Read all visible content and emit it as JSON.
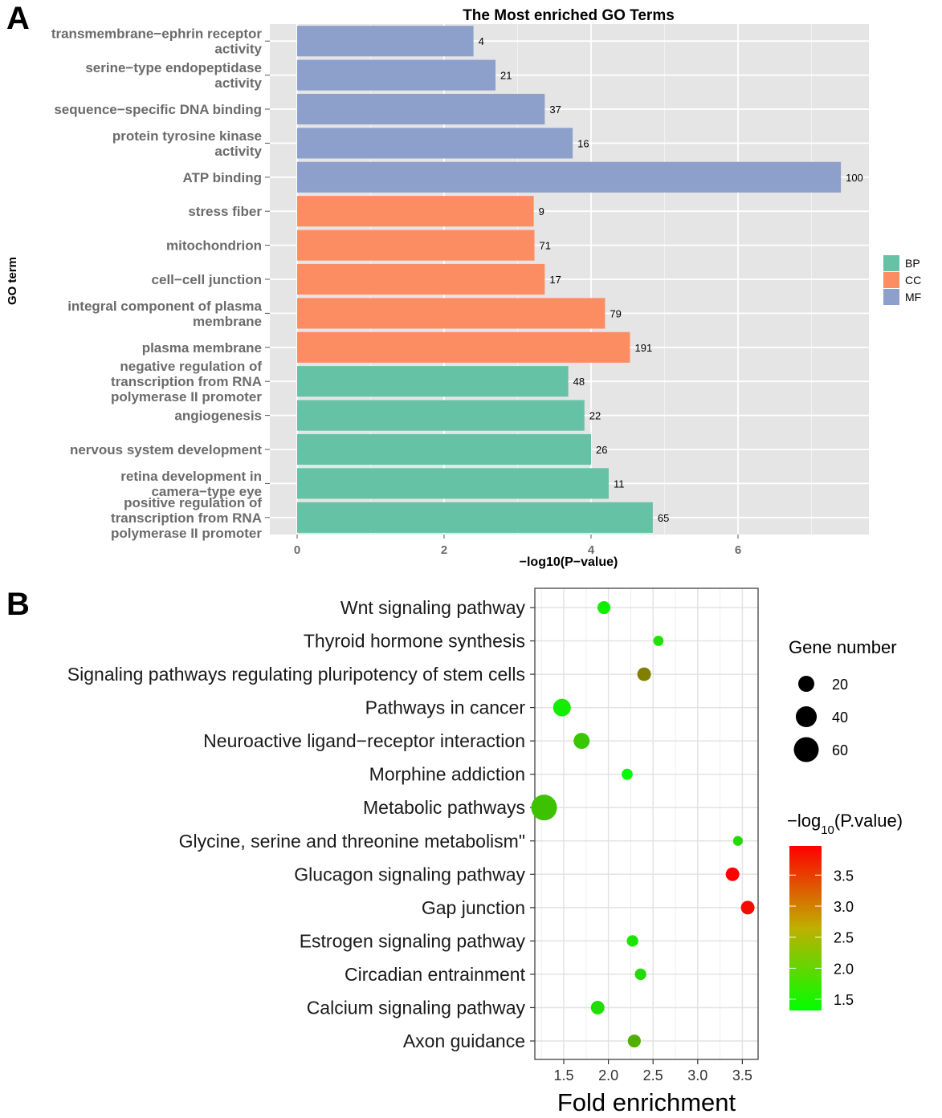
{
  "panels": {
    "a_label": "A",
    "b_label": "B"
  },
  "chart_data": [
    {
      "type": "bar",
      "orientation": "horizontal",
      "title": "The Most enriched GO Terms",
      "xlabel": "−log10(P−value)",
      "ylabel": "GO term",
      "xlim": [
        -0.35,
        7.8
      ],
      "xticks": [
        "0",
        "2",
        "4",
        "6"
      ],
      "xtick_values": [
        0,
        2,
        4,
        6
      ],
      "grid": true,
      "legend": {
        "placement": "right",
        "entries": [
          {
            "name": "BP",
            "color": "#66c2a5"
          },
          {
            "name": "CC",
            "color": "#fc8d62"
          },
          {
            "name": "MF",
            "color": "#8da0cb"
          }
        ]
      },
      "categories": [
        {
          "lines": [
            "transmembrane−ephrin receptor",
            "activity"
          ],
          "group": "MF",
          "value": 2.4,
          "count": "4"
        },
        {
          "lines": [
            "serine−type endopeptidase",
            "activity"
          ],
          "group": "MF",
          "value": 2.7,
          "count": "21"
        },
        {
          "lines": [
            "sequence−specific DNA binding"
          ],
          "group": "MF",
          "value": 3.37,
          "count": "37"
        },
        {
          "lines": [
            "protein tyrosine kinase",
            "activity"
          ],
          "group": "MF",
          "value": 3.75,
          "count": "16"
        },
        {
          "lines": [
            "ATP binding"
          ],
          "group": "MF",
          "value": 7.4,
          "count": "100"
        },
        {
          "lines": [
            "stress fiber"
          ],
          "group": "CC",
          "value": 3.22,
          "count": "9"
        },
        {
          "lines": [
            "mitochondrion"
          ],
          "group": "CC",
          "value": 3.23,
          "count": "71"
        },
        {
          "lines": [
            "cell−cell junction"
          ],
          "group": "CC",
          "value": 3.37,
          "count": "17"
        },
        {
          "lines": [
            "integral component of plasma",
            "membrane"
          ],
          "group": "CC",
          "value": 4.19,
          "count": "79"
        },
        {
          "lines": [
            "plasma membrane"
          ],
          "group": "CC",
          "value": 4.53,
          "count": "191"
        },
        {
          "lines": [
            "negative regulation of",
            "transcription from RNA",
            "polymerase II promoter"
          ],
          "group": "BP",
          "value": 3.69,
          "count": "48"
        },
        {
          "lines": [
            "angiogenesis"
          ],
          "group": "BP",
          "value": 3.91,
          "count": "22"
        },
        {
          "lines": [
            "nervous system development"
          ],
          "group": "BP",
          "value": 4.0,
          "count": "26"
        },
        {
          "lines": [
            "retina development in",
            "camera−type eye"
          ],
          "group": "BP",
          "value": 4.24,
          "count": "11"
        },
        {
          "lines": [
            "positive regulation of",
            "transcription from RNA",
            "polymerase II promoter"
          ],
          "group": "BP",
          "value": 4.84,
          "count": "65"
        }
      ]
    },
    {
      "type": "scatter",
      "subtype": "bubble",
      "title": "",
      "xlabel": "Fold enrichment",
      "ylabel": "",
      "xlim": [
        1.2,
        3.67
      ],
      "xticks": [
        "1.5",
        "2.0",
        "2.5",
        "3.0",
        "3.5"
      ],
      "xtick_values": [
        1.5,
        2.0,
        2.5,
        3.0,
        3.5
      ],
      "grid": true,
      "size_legend": {
        "title": "Gene number",
        "values": [
          20,
          40,
          60
        ],
        "labels": [
          "20",
          "40",
          "60"
        ]
      },
      "color_legend": {
        "title_prefix": "−log",
        "title_sub": "10",
        "title_suffix": "(P.value)",
        "range": [
          1.32,
          3.97
        ],
        "low_color": "#00ff00",
        "high_color": "#ff0000",
        "ticks": [
          3.5,
          3.0,
          2.5,
          2.0,
          1.5
        ],
        "tick_labels": [
          "3.5",
          "3.0",
          "2.5",
          "2.0",
          "1.5"
        ]
      },
      "points": [
        {
          "term": "Wnt signaling pathway",
          "fold_enrichment": 1.95,
          "gene_number": 10,
          "neg_log10_p": 1.5
        },
        {
          "term": "Thyroid hormone synthesis",
          "fold_enrichment": 2.56,
          "gene_number": 3,
          "neg_log10_p": 1.6
        },
        {
          "term": "Signaling pathways regulating pluripotency of stem cells",
          "fold_enrichment": 2.4,
          "gene_number": 12,
          "neg_log10_p": 2.65
        },
        {
          "term": "Pathways in cancer",
          "fold_enrichment": 1.48,
          "gene_number": 26,
          "neg_log10_p": 1.5
        },
        {
          "term": "Neuroactive ligand−receptor interaction",
          "fold_enrichment": 1.7,
          "gene_number": 20,
          "neg_log10_p": 1.9
        },
        {
          "term": "Morphine addiction",
          "fold_enrichment": 2.21,
          "gene_number": 5,
          "neg_log10_p": 1.35
        },
        {
          "term": "Metabolic pathways",
          "fold_enrichment": 1.28,
          "gene_number": 65,
          "neg_log10_p": 1.95
        },
        {
          "term": "Glycine, serine and threonine metabolism\"",
          "fold_enrichment": 3.45,
          "gene_number": 2,
          "neg_log10_p": 1.7
        },
        {
          "term": "Glucagon signaling pathway",
          "fold_enrichment": 3.39,
          "gene_number": 12,
          "neg_log10_p": 3.95
        },
        {
          "term": "Gap junction",
          "fold_enrichment": 3.56,
          "gene_number": 12,
          "neg_log10_p": 3.85
        },
        {
          "term": "Estrogen signaling pathway",
          "fold_enrichment": 2.27,
          "gene_number": 6,
          "neg_log10_p": 1.6
        },
        {
          "term": "Circadian entrainment",
          "fold_enrichment": 2.36,
          "gene_number": 6,
          "neg_log10_p": 1.7
        },
        {
          "term": "Calcium signaling pathway",
          "fold_enrichment": 1.88,
          "gene_number": 12,
          "neg_log10_p": 1.65
        },
        {
          "term": "Axon guidance",
          "fold_enrichment": 2.29,
          "gene_number": 10,
          "neg_log10_p": 2.15
        }
      ]
    }
  ]
}
